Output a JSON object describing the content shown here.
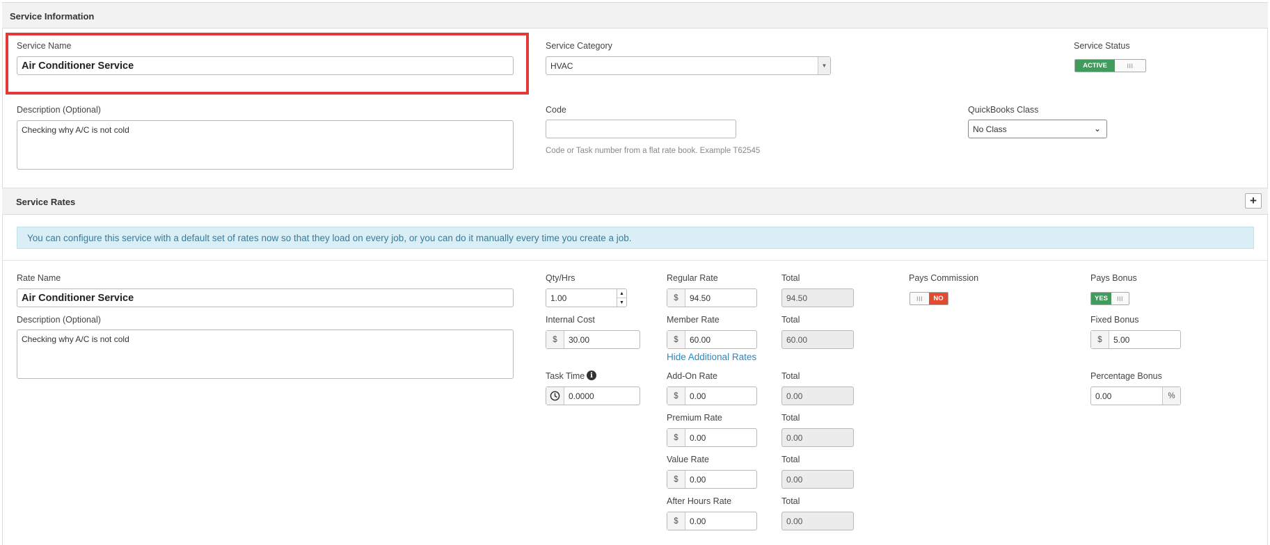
{
  "service_info": {
    "header": "Service Information",
    "service_name_label": "Service Name",
    "service_name_value": "Air Conditioner Service",
    "category_label": "Service Category",
    "category_value": "HVAC",
    "status_label": "Service Status",
    "status_toggle_on": "ACTIVE",
    "status_toggle_grip": "III",
    "description_label": "Description (Optional)",
    "description_value": "Checking why A/C is not cold",
    "code_label": "Code",
    "code_value": "",
    "code_hint": "Code or Task number from a flat rate book. Example T62545",
    "qb_class_label": "QuickBooks Class",
    "qb_class_value": "No Class"
  },
  "service_rates": {
    "header": "Service Rates",
    "add_button": "+",
    "info_message": "You can configure this service with a default set of rates now so that they load on every job, or you can do it manually every time you create a job.",
    "rate_name_label": "Rate Name",
    "rate_name_value": "Air Conditioner Service",
    "description_label": "Description (Optional)",
    "description_value": "Checking why A/C is not cold",
    "qty_label": "Qty/Hrs",
    "qty_value": "1.00",
    "internal_cost_label": "Internal Cost",
    "internal_cost_value": "30.00",
    "task_time_label": "Task Time",
    "task_time_value": "0.0000",
    "currency_symbol": "$",
    "percent_symbol": "%",
    "total_label": "Total",
    "regular_rate_label": "Regular Rate",
    "regular_rate_value": "94.50",
    "regular_total": "94.50",
    "member_rate_label": "Member Rate",
    "member_rate_value": "60.00",
    "member_total": "60.00",
    "hide_rates_link": "Hide Additional Rates",
    "addon_rate_label": "Add-On Rate",
    "addon_rate_value": "0.00",
    "addon_total": "0.00",
    "premium_rate_label": "Premium Rate",
    "premium_rate_value": "0.00",
    "premium_total": "0.00",
    "value_rate_label": "Value Rate",
    "value_rate_value": "0.00",
    "value_total": "0.00",
    "after_hours_rate_label": "After Hours Rate",
    "after_hours_rate_value": "0.00",
    "after_hours_total": "0.00",
    "pays_commission_label": "Pays Commission",
    "commission_toggle_off": "NO",
    "commission_toggle_grip": "III",
    "pays_bonus_label": "Pays Bonus",
    "bonus_toggle_on": "YES",
    "bonus_toggle_grip": "III",
    "fixed_bonus_label": "Fixed Bonus",
    "fixed_bonus_value": "5.00",
    "percentage_bonus_label": "Percentage Bonus",
    "percentage_bonus_value": "0.00"
  },
  "colors": {
    "highlight_border": "#e2393c",
    "toggle_on": "#3f9c5c",
    "toggle_off": "#e44a2f",
    "link": "#2a88c2",
    "info_bg": "#daeef6"
  }
}
